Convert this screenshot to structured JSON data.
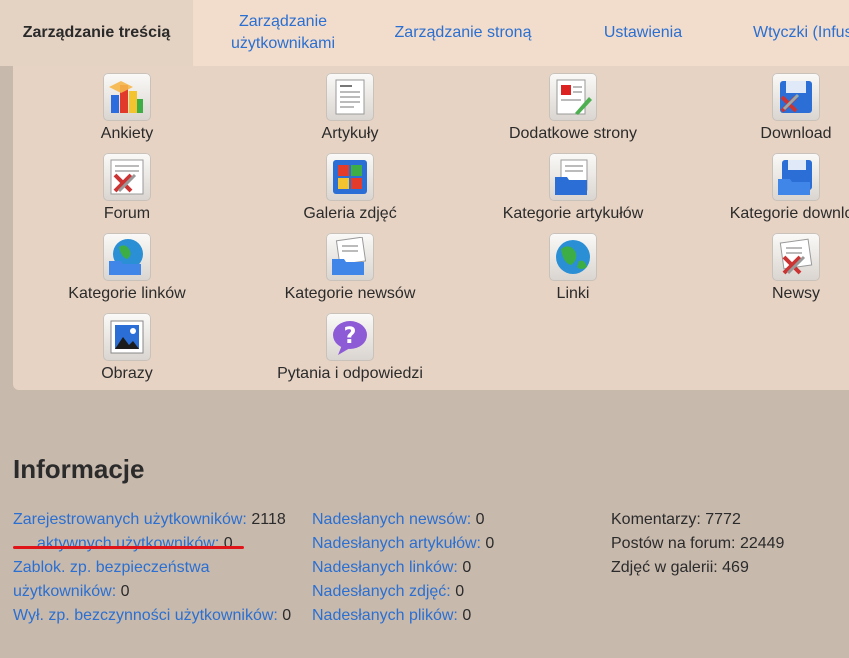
{
  "tabs": [
    {
      "label": "Zarządzanie treścią",
      "active": true
    },
    {
      "label": "Zarządzanie\nużytkownikami",
      "line1": "Zarządzanie",
      "line2": "użytkownikami"
    },
    {
      "label": "Zarządzanie stroną"
    },
    {
      "label": "Ustawienia"
    },
    {
      "label": "Wtyczki (Infusions)",
      "visible": "Wtyczki (Infus"
    }
  ],
  "admin_items": [
    {
      "label": "Ankiety",
      "icon": "polls-icon"
    },
    {
      "label": "Artykuły",
      "icon": "articles-icon"
    },
    {
      "label": "Dodatkowe strony",
      "icon": "custom-pages-icon"
    },
    {
      "label": "Download",
      "icon": "download-icon"
    },
    {
      "label": "Forum",
      "icon": "forum-icon"
    },
    {
      "label": "Galeria zdjęć",
      "icon": "photo-gallery-icon"
    },
    {
      "label": "Kategorie artykułów",
      "icon": "article-categories-icon"
    },
    {
      "label": "Kategorie downloa",
      "icon": "download-categories-icon"
    },
    {
      "label": "Kategorie linków",
      "icon": "link-categories-icon"
    },
    {
      "label": "Kategorie newsów",
      "icon": "news-categories-icon"
    },
    {
      "label": "Linki",
      "icon": "links-icon"
    },
    {
      "label": "Newsy",
      "icon": "news-icon"
    },
    {
      "label": "Obrazy",
      "icon": "images-icon"
    },
    {
      "label": "Pytania i odpowiedzi",
      "icon": "faq-icon"
    }
  ],
  "info": {
    "title": "Informacje",
    "users": {
      "registered_label": "Zarejestrowanych użytkowników:",
      "registered_value": "2118",
      "active_label": "aktywnych użytkowników:",
      "active_value": "0",
      "blocked_label_1": "Zablok. zp. bezpieczeństwa",
      "blocked_label_2": "użytkowników:",
      "blocked_value": "0",
      "inactive_label": "Wył. zp. bezczynności użytkowników:",
      "inactive_value": "0"
    },
    "submissions": {
      "news_label": "Nadesłanych newsów:",
      "news_value": "0",
      "articles_label": "Nadesłanych artykułów:",
      "articles_value": "0",
      "links_label": "Nadesłanych linków:",
      "links_value": "0",
      "photos_label": "Nadesłanych zdjęć:",
      "photos_value": "0",
      "files_label": "Nadesłanych plików:",
      "files_value": "0"
    },
    "stats": {
      "comments": "Komentarzy: 7772",
      "forum_posts": "Postów na forum: 22449",
      "gallery_photos": "Zdjęć w galerii: 469"
    }
  },
  "colors": {
    "link": "#2a6fd1",
    "highlight_mark": "#e0151a",
    "background": "#c8b9ad",
    "panel": "#e6d3c4",
    "tabbar": "#f2dccb"
  }
}
